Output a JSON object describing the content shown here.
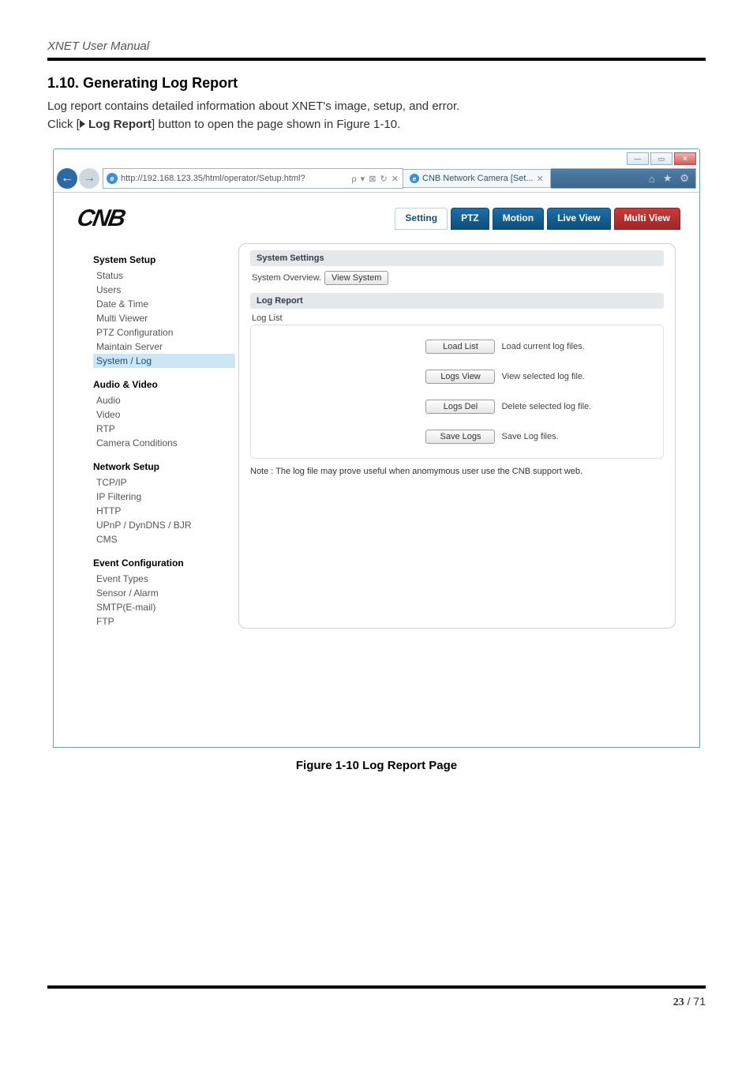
{
  "doc": {
    "header": "XNET User Manual",
    "section_number": "1.10.",
    "section_title": "Generating Log Report",
    "para1": "Log report contains detailed information about XNET's image, setup, and error.",
    "para2_a": "Click [",
    "para2_b_bold": "Log Report",
    "para2_c": "] button to open the page shown in Figure 1-10.",
    "figure_caption": "Figure 1-10 Log Report Page",
    "page_current": "23",
    "page_sep": " / ",
    "page_total": "71"
  },
  "browser": {
    "url": "http://192.168.123.35/html/operator/Setup.html?",
    "url_addons": "ρ ▾  ⊠  ↻  ✕",
    "tab_title": "CNB Network Camera [Set...",
    "tab_close": "✕",
    "win_min": "—",
    "win_max": "▭",
    "win_close": "✕"
  },
  "app": {
    "brand": "CNB",
    "tabs": {
      "setting": "Setting",
      "ptz": "PTZ",
      "motion": "Motion",
      "live": "Live View",
      "multi": "Multi View"
    }
  },
  "sidebar": {
    "g1": "System Setup",
    "g1_items": [
      "Status",
      "Users",
      "Date & Time",
      "Multi Viewer",
      "PTZ Configuration",
      "Maintain Server",
      "System / Log"
    ],
    "g2": "Audio & Video",
    "g2_items": [
      "Audio",
      "Video",
      "RTP",
      "Camera Conditions"
    ],
    "g3": "Network Setup",
    "g3_items": [
      "TCP/IP",
      "IP Filtering",
      "HTTP",
      "UPnP / DynDNS / BJR",
      "CMS"
    ],
    "g4": "Event Configuration",
    "g4_items": [
      "Event Types",
      "Sensor / Alarm",
      "SMTP(E-mail)",
      "FTP"
    ]
  },
  "content": {
    "sys_settings": "System Settings",
    "sys_overview_label": "System Overview.",
    "view_system_btn": "View System",
    "log_report": "Log Report",
    "log_list": "Log List",
    "load_list_btn": "Load List",
    "load_list_txt": "Load current log files.",
    "logs_view_btn": "Logs View",
    "logs_view_txt": "View selected log file.",
    "logs_del_btn": "Logs Del",
    "logs_del_txt": "Delete selected log file.",
    "save_logs_btn": "Save Logs",
    "save_logs_txt": "Save Log files.",
    "note": "Note : The log file may prove useful when anomymous user use the CNB support web."
  }
}
